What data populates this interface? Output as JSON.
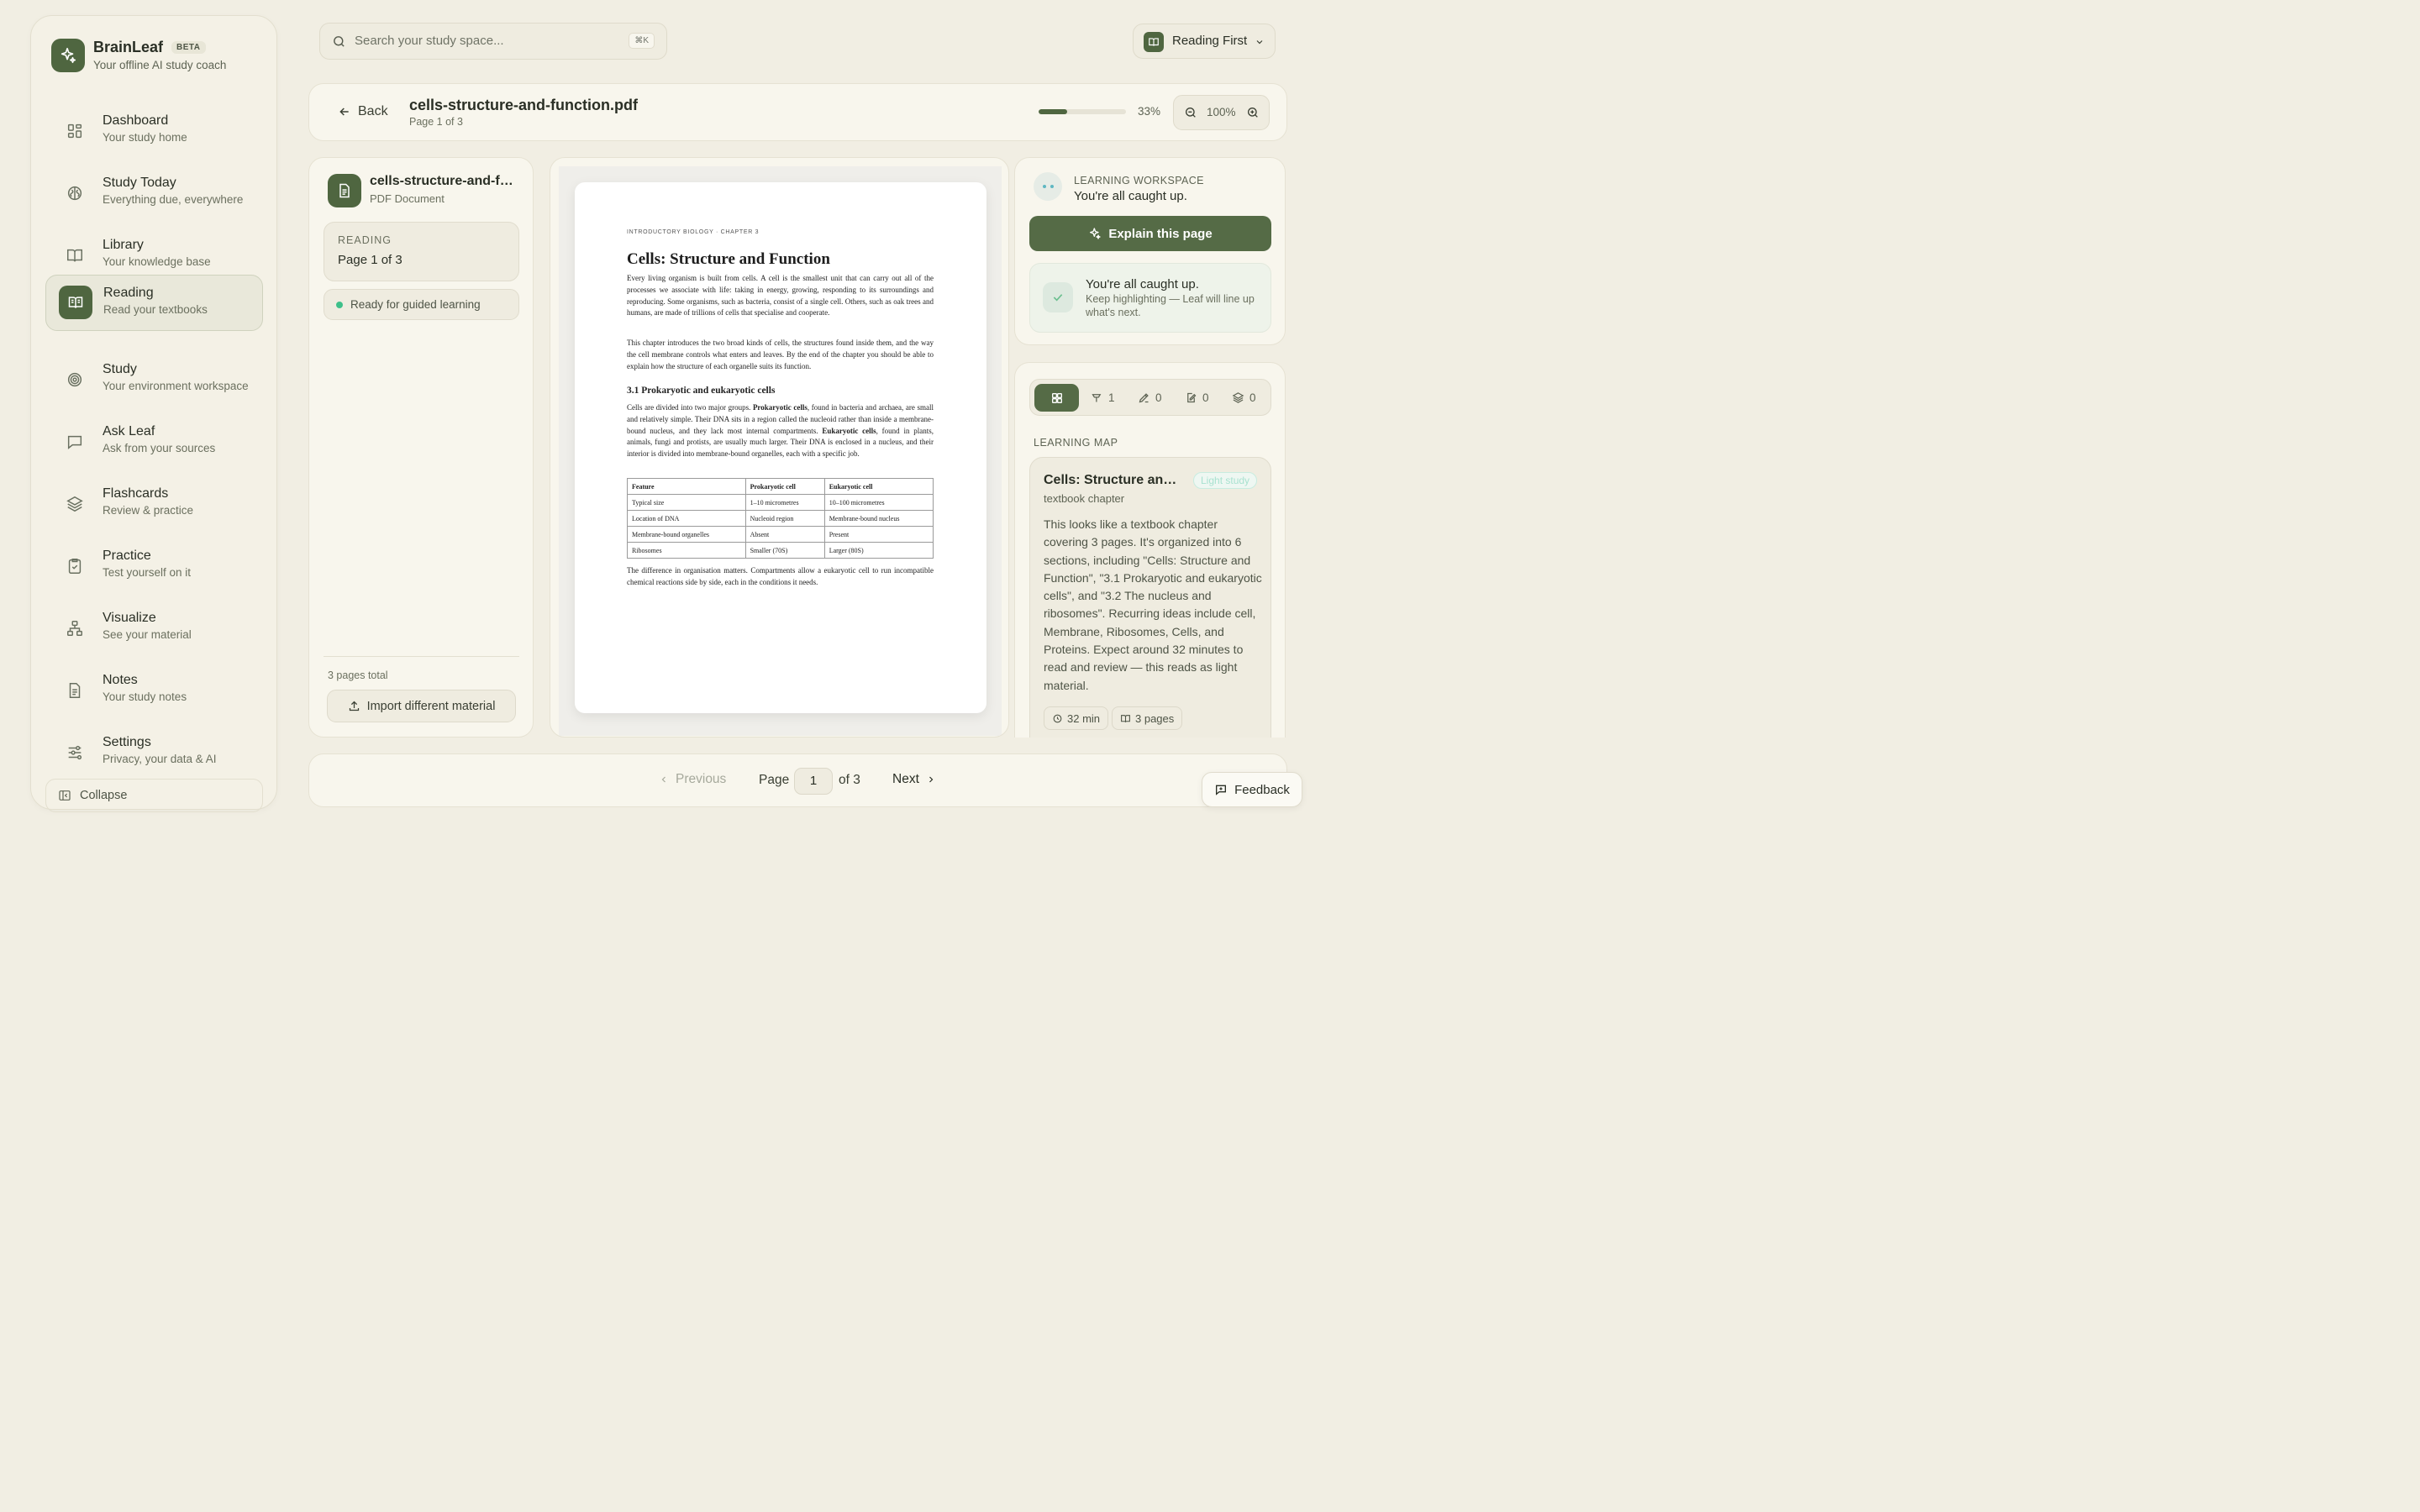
{
  "brand": {
    "name": "BrainLeaf",
    "badge": "BETA",
    "tagline": "Your offline AI study coach"
  },
  "nav": [
    {
      "label": "Dashboard",
      "sub": "Your study home",
      "icon": "grid-icon"
    },
    {
      "label": "Study Today",
      "sub": "Everything due, everywhere",
      "icon": "brain-icon"
    },
    {
      "label": "Library",
      "sub": "Your knowledge base",
      "icon": "book-icon"
    },
    {
      "label": "Reading",
      "sub": "Read your textbooks",
      "icon": "book-open-icon",
      "active": true
    },
    {
      "label": "Study",
      "sub": "Your environment workspace",
      "icon": "target-icon"
    },
    {
      "label": "Ask Leaf",
      "sub": "Ask from your sources",
      "icon": "chat-icon"
    },
    {
      "label": "Flashcards",
      "sub": "Review & practice",
      "icon": "layers-icon"
    },
    {
      "label": "Practice",
      "sub": "Test yourself on it",
      "icon": "clipboard-check-icon"
    },
    {
      "label": "Visualize",
      "sub": "See your material",
      "icon": "network-icon"
    },
    {
      "label": "Notes",
      "sub": "Your study notes",
      "icon": "document-icon"
    },
    {
      "label": "Settings",
      "sub": "Privacy, your data & AI",
      "icon": "sliders-icon"
    }
  ],
  "collapse_label": "Collapse",
  "search": {
    "placeholder": "Search your study space...",
    "shortcut": "⌘K"
  },
  "mode": {
    "label": "Reading First"
  },
  "doc": {
    "back_label": "Back",
    "filename": "cells-structure-and-function.pdf",
    "page_info": "Page 1 of 3",
    "progress_pct": 33,
    "progress_label": "33%",
    "zoom": "100%"
  },
  "left_panel": {
    "file_title": "cells-structure-and-function.pdf",
    "file_type": "PDF Document",
    "reading_label": "READING",
    "reading_value": "Page 1 of 3",
    "status": "Ready for guided learning",
    "total": "3 pages total",
    "import_label": "Import different material"
  },
  "pdf": {
    "kicker": "INTRODUCTORY BIOLOGY · CHAPTER 3",
    "title": "Cells: Structure and Function",
    "p1": "Every living organism is built from cells. A cell is the smallest unit that can carry out all of the processes we associate with life: taking in energy, growing, responding to its surroundings and reproducing. Some organisms, such as bacteria, consist of a single cell. Others, such as oak trees and humans, are made of trillions of cells that specialise and cooperate.",
    "p2": "This chapter introduces the two broad kinds of cells, the structures found inside them, and the way the cell membrane controls what enters and leaves. By the end of the chapter you should be able to explain how the structure of each organelle suits its function.",
    "h2": "3.1 Prokaryotic and eukaryotic cells",
    "p3_a": "Cells are divided into two major groups. ",
    "p3_b": "Prokaryotic cells",
    "p3_c": ", found in bacteria and archaea, are small and relatively simple. Their DNA sits in a region called the nucleoid rather than inside a membrane-bound nucleus, and they lack most internal compartments. ",
    "p3_d": "Eukaryotic cells",
    "p3_e": ", found in plants, animals, fungi and protists, are usually much larger. Their DNA is enclosed in a nucleus, and their interior is divided into membrane-bound organelles, each with a specific job.",
    "table": [
      [
        "Feature",
        "Prokaryotic cell",
        "Eukaryotic cell"
      ],
      [
        "Typical size",
        "1–10 micrometres",
        "10–100 micrometres"
      ],
      [
        "Location of DNA",
        "Nucleoid region",
        "Membrane-bound nucleus"
      ],
      [
        "Membrane-bound organelles",
        "Absent",
        "Present"
      ],
      [
        "Ribosomes",
        "Smaller (70S)",
        "Larger (80S)"
      ]
    ],
    "p4": "The difference in organisation matters. Compartments allow a eukaryotic cell to run incompatible chemical reactions side by side, each in the conditions it needs."
  },
  "workspace": {
    "kicker": "LEARNING WORKSPACE",
    "status": "You're all caught up.",
    "explain_label": "Explain this page",
    "caught_title": "You're all caught up.",
    "caught_sub": "Keep highlighting — Leaf will line up what's next."
  },
  "map": {
    "tab_counts": [
      "1",
      "0",
      "0",
      "0"
    ],
    "section_label": "LEARNING MAP",
    "title": "Cells: Structure and Function",
    "badge": "Light study",
    "subtitle": "textbook chapter",
    "description": "This looks like a textbook chapter covering 3 pages. It's organized into 6 sections, including \"Cells: Structure and Function\", \"3.1 Prokaryotic and eukaryotic cells\", and \"3.2 The nucleus and ribosomes\". Recurring ideas include cell, Membrane, Ribosomes, Cells, and Proteins. Expect around 32 minutes to read and review — this reads as light material.",
    "time_chip": "32 min",
    "pages_chip": "3 pages"
  },
  "pager": {
    "prev": "Previous",
    "page_label": "Page",
    "page_value": "1",
    "of_label": "of 3",
    "next": "Next"
  },
  "feedback_label": "Feedback",
  "colors": {
    "accent": "#4f6640",
    "bg": "#f1eee3",
    "ready_dot": "#3ec08a"
  }
}
